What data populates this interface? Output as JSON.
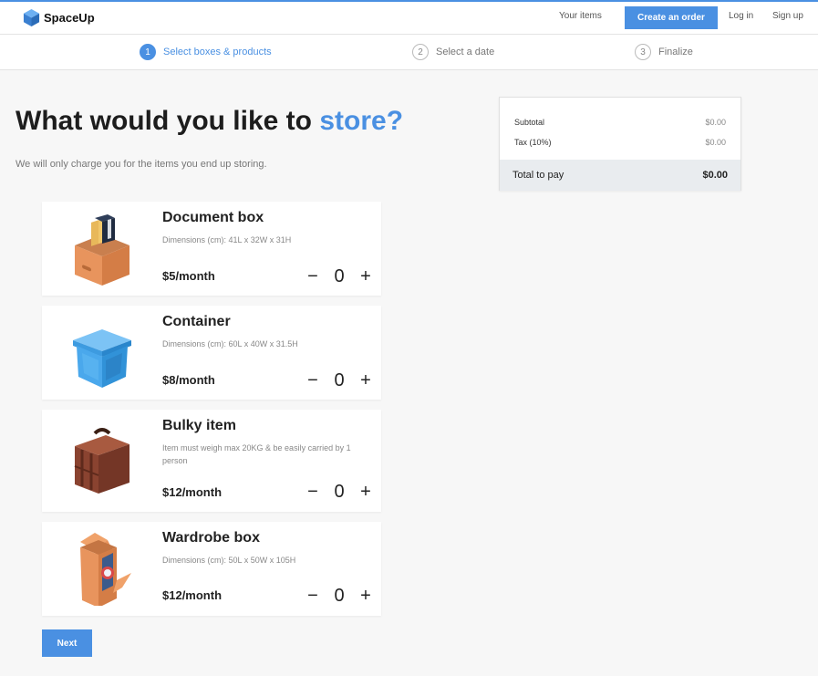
{
  "nav": {
    "brand": "SpaceUp",
    "your_items": "Your items",
    "create_order": "Create an order",
    "log_in": "Log in",
    "sign_up": "Sign up"
  },
  "steps": [
    {
      "num": "1",
      "label": "Select boxes & products",
      "active": true
    },
    {
      "num": "2",
      "label": "Select a date",
      "active": false
    },
    {
      "num": "3",
      "label": "Finalize",
      "active": false
    }
  ],
  "main": {
    "heading_prefix": "What would you like to",
    "heading_accent": "store?",
    "subheading": "We will only charge you for the items you end up storing."
  },
  "products": [
    {
      "title": "Document box",
      "description": "Dimensions (cm): 41L x 32W x 31H",
      "price": "$5/month",
      "quantity": "0",
      "icon": "document-box-icon"
    },
    {
      "title": "Container",
      "description": "Dimensions (cm): 60L x 40W x 31.5H",
      "price": "$8/month",
      "quantity": "0",
      "icon": "container-icon"
    },
    {
      "title": "Bulky item",
      "description": "Item must weigh max 20KG & be easily carried by 1 person",
      "price": "$12/month",
      "quantity": "0",
      "icon": "suitcase-icon"
    },
    {
      "title": "Wardrobe box",
      "description": "Dimensions (cm): 50L x 50W x 105H",
      "price": "$12/month",
      "quantity": "0",
      "icon": "wardrobe-box-icon"
    }
  ],
  "qty_controls": {
    "minus": "−",
    "plus": "+"
  },
  "next_label": "Next",
  "summary": {
    "subtotal_label": "Subtotal",
    "subtotal_value": "$0.00",
    "tax_label": "Tax (10%)",
    "tax_value": "$0.00",
    "total_label": "Total to pay",
    "total_value": "$0.00"
  },
  "colors": {
    "accent": "#4a90e2",
    "background": "#f7f7f7"
  }
}
